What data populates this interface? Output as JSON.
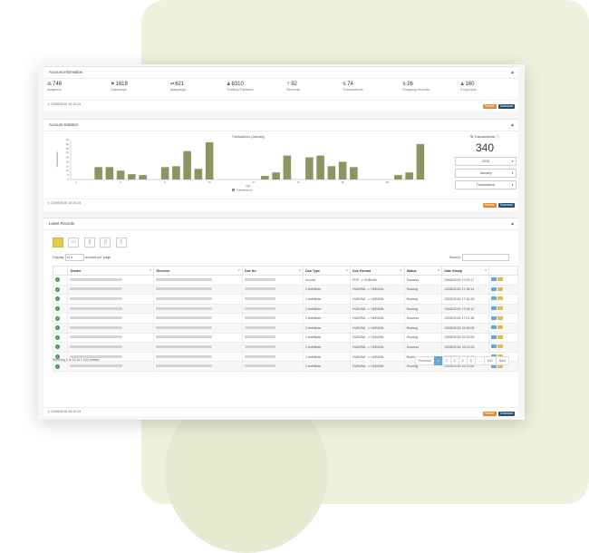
{
  "account_info": {
    "title": "Account information",
    "stats": [
      {
        "value": "748",
        "label": "Adapters",
        "icon": "sitemap-icon",
        "glyph": "⁂"
      },
      {
        "value": "1619",
        "label": "Gateways",
        "icon": "signpost-icon",
        "glyph": "⚑"
      },
      {
        "value": "621",
        "label": "Mappings",
        "icon": "exchange-icon",
        "glyph": "⇄"
      },
      {
        "value": "8310",
        "label": "Trading Partners",
        "icon": "users-icon",
        "glyph": "♟"
      },
      {
        "value": "92",
        "label": "Records",
        "icon": "upload-icon",
        "glyph": "⇡"
      },
      {
        "value": "74",
        "label": "Transactions",
        "icon": "transactions-icon",
        "glyph": "⇅"
      },
      {
        "value": "26",
        "label": "Shipping records",
        "icon": "shipping-icon",
        "glyph": "⇅"
      },
      {
        "value": "160",
        "label": "Endpoints",
        "icon": "user-icon",
        "glyph": "♟"
      }
    ],
    "timestamp": "23/08/2018 10:10:23",
    "refresh": "Refresh",
    "download": "Download"
  },
  "account_stats": {
    "title": "Account statistics",
    "timestamp": "23/08/2018 10:10:23",
    "refresh": "Refresh",
    "download": "Download",
    "side": {
      "label": "Transactions",
      "value": "340",
      "year": "2018",
      "month": "January",
      "type": "Transactions"
    }
  },
  "chart_data": {
    "type": "bar",
    "title": "Transactions (January)",
    "xlabel": "Day",
    "ylabel": "Transactions",
    "legend": [
      "Transactions"
    ],
    "color": "#8c9461",
    "categories": [
      1,
      2,
      3,
      4,
      5,
      6,
      7,
      8,
      9,
      10,
      11,
      12,
      13,
      14,
      15,
      16,
      17,
      18,
      19,
      20,
      21,
      22,
      23,
      24,
      25,
      26,
      27,
      28,
      29,
      30,
      31
    ],
    "values": [
      0,
      0,
      14,
      14,
      10,
      6,
      5,
      0,
      14,
      15,
      32,
      12,
      42,
      0,
      0,
      0,
      0,
      4,
      8,
      27,
      0,
      25,
      27,
      15,
      20,
      14,
      0,
      0,
      0,
      5,
      8,
      40
    ],
    "ylim": [
      0,
      45
    ],
    "yticks": [
      0,
      5,
      10,
      15,
      20,
      25,
      30,
      35,
      40,
      45
    ],
    "xticks": [
      1,
      5,
      9,
      13,
      17,
      21,
      25,
      29
    ]
  },
  "latest_records": {
    "title": "Latest Records",
    "display_label": "Display",
    "per_page_value": "10",
    "per_page_label": "records per page",
    "search_label": "Search:",
    "columns": [
      "Sender",
      "Receiver",
      "Doc No",
      "Doc Type",
      "Doc Format",
      "Status",
      "Date Stamp"
    ],
    "rows": [
      {
        "doc_type": "Invoice",
        "doc_format": "PDF -> HUBXML",
        "status": "Success",
        "date": "23/08/2018 17:29:17"
      },
      {
        "doc_type": "CreditNote",
        "doc_format": "HUBXML -> HUBXML",
        "status": "Routing",
        "date": "23/08/2018 17:38:14"
      },
      {
        "doc_type": "CreditNote",
        "doc_format": "HUBXML -> HUBXML",
        "status": "Routing",
        "date": "23/08/2018 17:34:36"
      },
      {
        "doc_type": "CreditNote",
        "doc_format": "HUBXML -> HUBXML",
        "status": "Routing",
        "date": "23/08/2018 17:06:12"
      },
      {
        "doc_type": "CreditNote",
        "doc_format": "HUBXML -> HUBXML",
        "status": "Success",
        "date": "23/08/2018 17:01:36"
      },
      {
        "doc_type": "CreditNote",
        "doc_format": "HUBXML -> HUBXML",
        "status": "Routing",
        "date": "23/08/2018 15:26:05"
      },
      {
        "doc_type": "CreditNote",
        "doc_format": "HUBXML -> HUBXML",
        "status": "Routing",
        "date": "23/08/2018 15:33:54"
      },
      {
        "doc_type": "CreditNote",
        "doc_format": "HUBXML -> HUBXML",
        "status": "Success",
        "date": "23/08/2018 15:21:53"
      },
      {
        "doc_type": "CreditNote",
        "doc_format": "HUBXML -> HUBXML",
        "status": "Routing",
        "date": "23/08/2018 15:13:58"
      },
      {
        "doc_type": "CreditNote",
        "doc_format": "HUBXML -> HUBXML",
        "status": "Routing",
        "date": "23/08/2018 15:11:06"
      }
    ],
    "showing": "Showing 1 to 10 of 1,000 entries",
    "pagination": [
      "Previous",
      "1",
      "2",
      "3",
      "4",
      "5",
      "...",
      "100",
      "Next"
    ],
    "timestamp": "23/08/2018 10:10:23",
    "refresh": "Refresh",
    "download": "Download"
  }
}
